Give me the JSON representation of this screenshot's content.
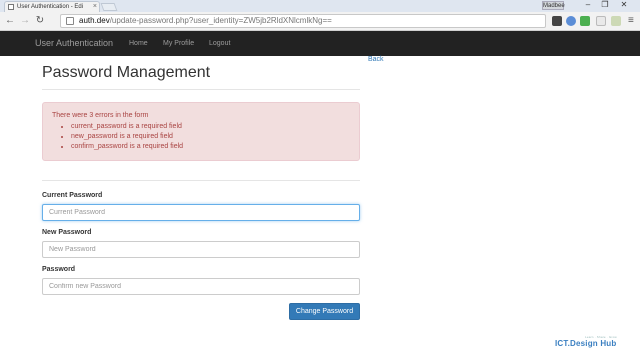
{
  "browser": {
    "tab_title": "User Authentication - Edi",
    "user_badge": "Madbee",
    "url_host": "auth.dev",
    "url_rest": "/update-password.php?user_identity=ZW5jb2RldXNlcmlkNg=="
  },
  "navbar": {
    "brand": "User Authentication",
    "links": [
      "Home",
      "My Profile",
      "Logout"
    ]
  },
  "page": {
    "title": "Password Management",
    "back_link": "Back"
  },
  "alert": {
    "heading": "There were 3 errors in the form",
    "errors": [
      "current_password is a required field",
      "new_password is a required field",
      "confirm_password is a required field"
    ]
  },
  "form": {
    "current": {
      "label": "Current Password",
      "placeholder": "Current Password",
      "value": ""
    },
    "new": {
      "label": "New Password",
      "placeholder": "New Password",
      "value": ""
    },
    "confirm": {
      "label": "Password",
      "placeholder": "Confirm new Password",
      "value": ""
    },
    "submit_label": "Change Password"
  },
  "watermark": {
    "text": "ICT.Design Hub",
    "sub": "Learn . Share . Grow"
  },
  "colors": {
    "navbar_bg": "#222222",
    "primary": "#337ab7",
    "alert_bg": "#f2dede",
    "alert_text": "#a94442"
  }
}
